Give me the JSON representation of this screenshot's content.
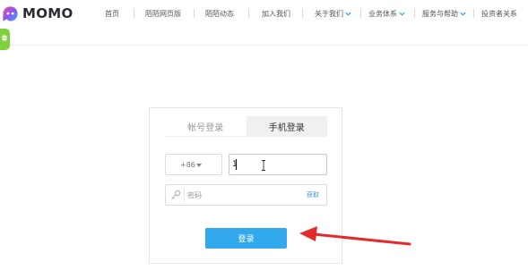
{
  "brand": {
    "name": "MOMO",
    "accent": "#7b5cf0"
  },
  "nav": {
    "items": [
      {
        "label": "首页",
        "dropdown": false
      },
      {
        "label": "陌陌网页版",
        "dropdown": false
      },
      {
        "label": "陌陌动态",
        "dropdown": false
      },
      {
        "label": "加入我们",
        "dropdown": false
      },
      {
        "label": "关于我们",
        "dropdown": true
      },
      {
        "label": "业务体系",
        "dropdown": true
      },
      {
        "label": "服务与帮助",
        "dropdown": true
      },
      {
        "label": "投资者关系",
        "dropdown": false
      }
    ]
  },
  "login": {
    "tabs": [
      {
        "label": "帐号登录",
        "active": false
      },
      {
        "label": "手机登录",
        "active": true
      }
    ],
    "country_code": "+86",
    "phone_value": "1",
    "password_placeholder": "密码",
    "password_link": "获取",
    "submit_label": "登录"
  },
  "colors": {
    "button": "#33a9ed",
    "side_tab": "#7fd13b",
    "arrow": "#e32b2b"
  }
}
